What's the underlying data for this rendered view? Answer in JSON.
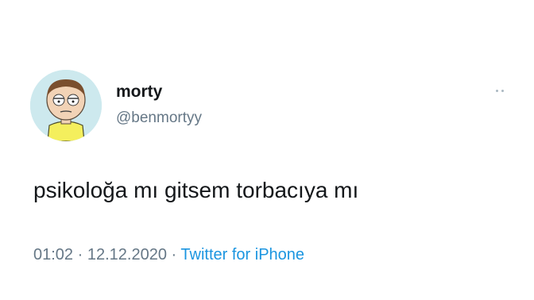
{
  "tweet": {
    "display_name": "morty",
    "username": "@benmortyy",
    "text": "psikoloğa mı gitsem torbacıya mı",
    "time": "01:02",
    "separator": "·",
    "date": "12.12.2020",
    "source": "Twitter for iPhone",
    "avatar_icon": "morty-avatar-icon",
    "more_icon": "more-options-icon"
  },
  "colors": {
    "text": "#14171a",
    "secondary": "#657786",
    "link": "#1b95e0",
    "avatar_bg": "#cde9ee"
  }
}
